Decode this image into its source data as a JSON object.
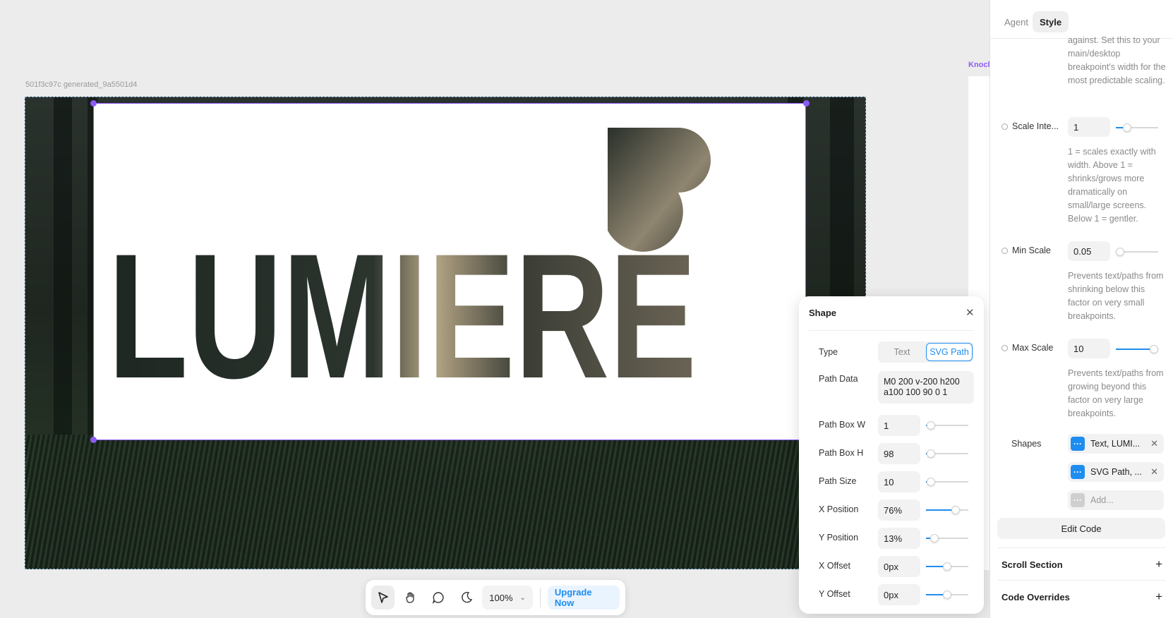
{
  "canvas": {
    "frame_label": "501f3c97c generated_9a5501d4",
    "knock_label": "Knocl",
    "logo_text": "LUMIERE"
  },
  "toolbar": {
    "zoom": "100%",
    "upgrade_label": "Upgrade Now"
  },
  "shape_panel": {
    "title": "Shape",
    "type_label": "Type",
    "type_options": [
      "Text",
      "SVG Path"
    ],
    "type_selected": "SVG Path",
    "path_data_label": "Path Data",
    "path_data_value": "M0 200 v-200 h200 a100 100 90 0 1",
    "rows": [
      {
        "label": "Path Box W",
        "value": "1",
        "level": 0.02
      },
      {
        "label": "Path Box H",
        "value": "98",
        "level": 0.03
      },
      {
        "label": "Path Size",
        "value": "10",
        "level": 0.02
      },
      {
        "label": "X Position",
        "value": "76%",
        "level": 0.76
      },
      {
        "label": "Y Position",
        "value": "13%",
        "level": 0.13
      },
      {
        "label": "X Offset",
        "value": "0px",
        "level": 0.5
      },
      {
        "label": "Y Offset",
        "value": "0px",
        "level": 0.5
      }
    ]
  },
  "sidebar": {
    "tabs": [
      "Agent",
      "Style"
    ],
    "active_tab": "Style",
    "top_help": "against. Set this to your main/desktop breakpoint's width for the most predictable scaling.",
    "scale_intensity": {
      "label": "Scale Inte...",
      "value": "1",
      "level": 0.2,
      "help": "1 = scales exactly with width. Above 1 = shrinks/grows more dramatically on small/large screens. Below 1 = gentler."
    },
    "min_scale": {
      "label": "Min Scale",
      "value": "0.05",
      "level": 0.0,
      "help": "Prevents text/paths from shrinking below this factor on very small breakpoints."
    },
    "max_scale": {
      "label": "Max Scale",
      "value": "10",
      "level": 1.0,
      "help": "Prevents text/paths from growing beyond this factor on very large breakpoints."
    },
    "shapes_label": "Shapes",
    "shapes": [
      "Text, LUMI...",
      "SVG Path, ..."
    ],
    "add_label": "Add...",
    "edit_code": "Edit Code",
    "scroll_section": "Scroll Section",
    "code_overrides": "Code Overrides"
  },
  "colors": {
    "accent": "#1e8df0",
    "selection": "#8b5cf6"
  }
}
